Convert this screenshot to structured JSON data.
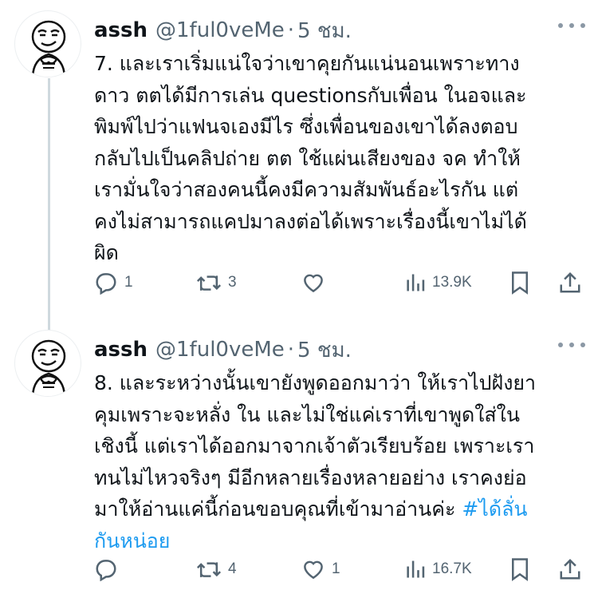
{
  "tweets": [
    {
      "name": "assh",
      "handle": "@1ful0veMe",
      "separator": "·",
      "time": "5 ชม.",
      "text_lines": [
        "7. และเราเริ่มแน่ใจว่าเขาคุยกันแน่นอนเพราะทาง",
        "ดาว ตตได้มีการเล่น questionsกับเพื่อน ในอจและ",
        "พิมพ์ไปว่าแฟนจเองมีไร ซึ่งเพื่อนของเขาได้ลงตอบ",
        "กลับไปเป็นคลิปถ่าย ตต ใช้แผ่นเสียงของ จค  ทำให้",
        "เรามั่นใจว่าสองคนนี้คงมีความสัมพันธ์อะไรกัน แต่",
        "คงไม่สามารถแคปมาลงต่อได้เพราะเรื่องนี้เขาไม่ได้",
        "ผิด"
      ],
      "replies": "1",
      "retweets": "3",
      "likes": "",
      "views": "13.9K"
    },
    {
      "name": "assh",
      "handle": "@1ful0veMe",
      "separator": "·",
      "time": "5 ชม.",
      "text_lines": [
        "8. และระหว่างนั้นเขายังพูดออกมาว่า ให้เราไปฝังยา",
        "คุมเพราะจะหลั่ง ใน และไม่ใช่แค่เราที่เขาพูดใส่ใน",
        "เชิงนี้ แต่เราได้ออกมาจากเจ้าตัวเรียบร้อย เพราะเรา",
        "ทนไม่ไหวจริงๆ มีอีกหลายเรื่องหลายอย่าง เราคงย่อ",
        "มาให้อ่านแค่นี้ก่อนขอบคุณที่เข้ามาอ่านค่ะ "
      ],
      "hashtag_inline": "#ได้ลั่น",
      "hashtag_cont": "กันหน่อย",
      "replies": "",
      "retweets": "4",
      "likes": "1",
      "views": "16.7K"
    }
  ],
  "colors": {
    "text": "#0f1419",
    "secondary": "#536471",
    "link": "#1d9bf0",
    "thread_line": "#cfd9de"
  },
  "icons": [
    "reply-icon",
    "retweet-icon",
    "like-icon",
    "views-icon",
    "bookmark-icon",
    "share-icon",
    "more-icon",
    "avatar"
  ]
}
